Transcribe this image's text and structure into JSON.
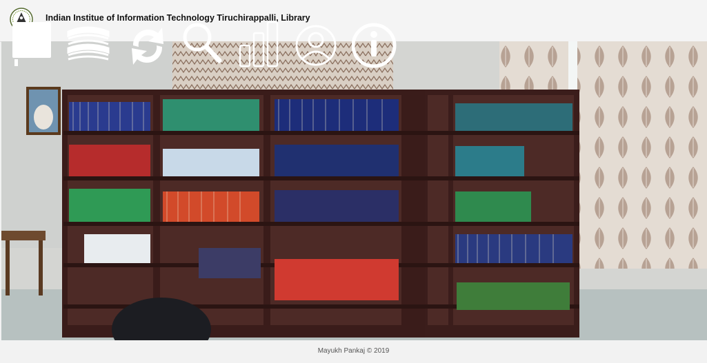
{
  "header": {
    "title": "Indian Institue of Information Technology Tiruchirappalli, Library",
    "logo_icon": "iiit-trichy-emblem"
  },
  "nav": {
    "icons": [
      "catalogue-book-icon",
      "books-stack-icon",
      "renew-sync-icon",
      "search-icon",
      "statistics-bar-chart-icon",
      "user-profile-icon",
      "info-icon"
    ],
    "icon_color": "#ffffff"
  },
  "background": {
    "subject": "library bookshelves photo"
  },
  "footer": {
    "credit": "Mayukh Pankaj © 2019"
  }
}
